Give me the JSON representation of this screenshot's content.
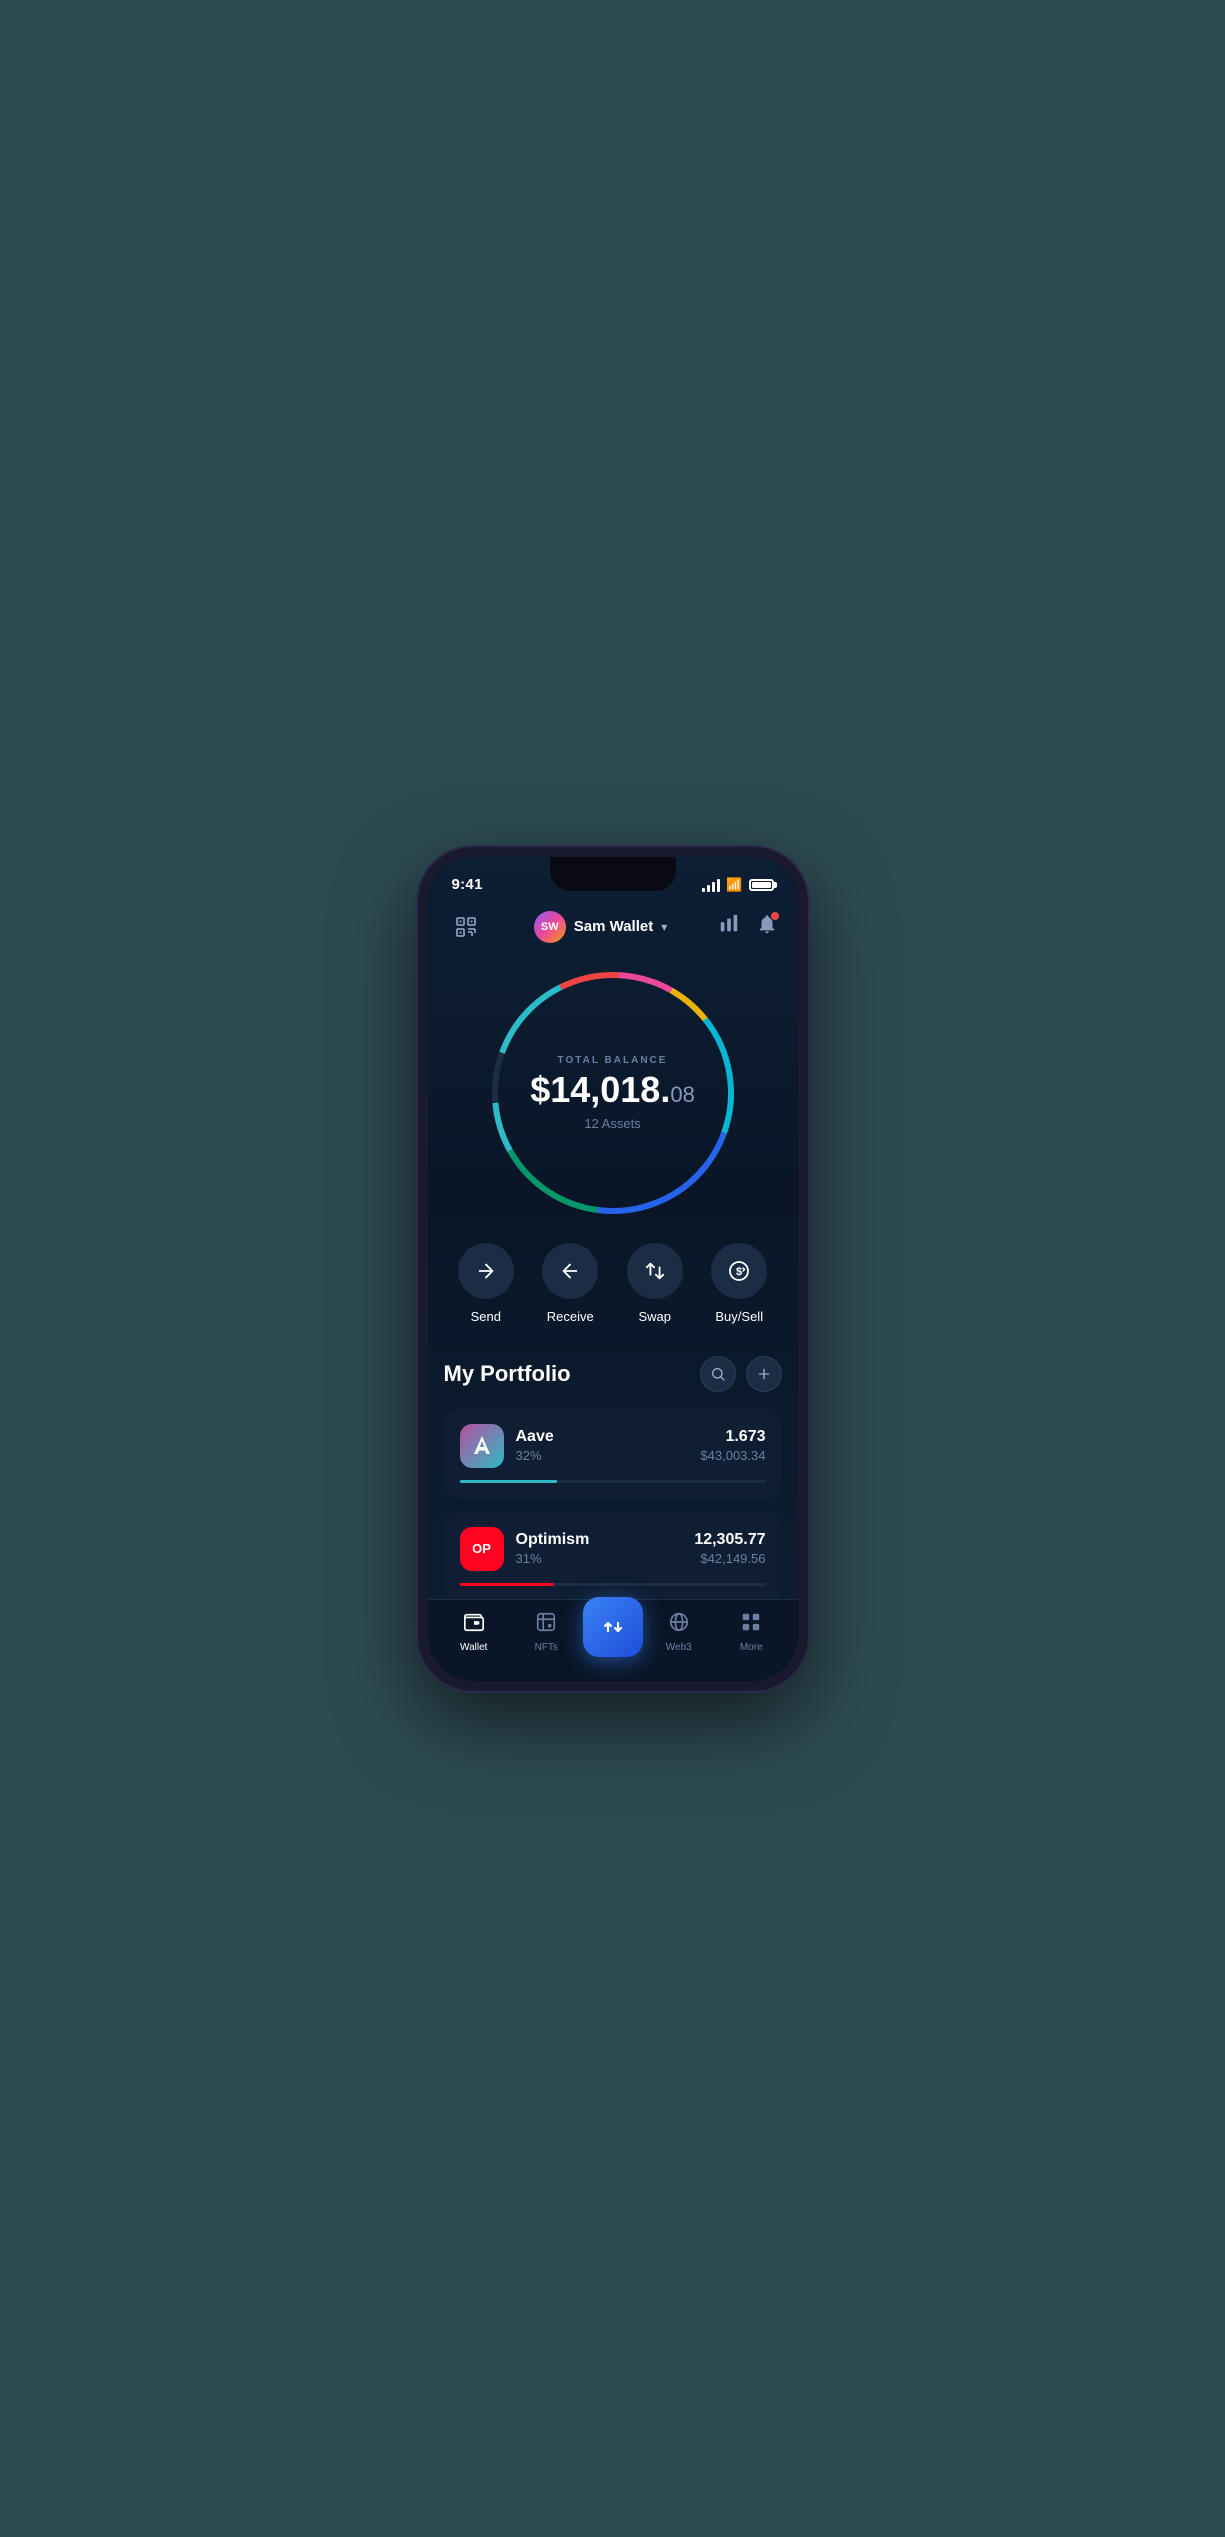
{
  "status_bar": {
    "time": "9:41"
  },
  "header": {
    "scan_label": "scan",
    "wallet_initials": "SW",
    "wallet_name": "Sam Wallet",
    "chevron": "▾",
    "chart_label": "chart",
    "notification_label": "notification"
  },
  "balance": {
    "label": "TOTAL BALANCE",
    "amount_main": "$14,018.",
    "amount_cents": "08",
    "assets_label": "12 Assets"
  },
  "actions": [
    {
      "id": "send",
      "label": "Send",
      "icon": "→"
    },
    {
      "id": "receive",
      "label": "Receive",
      "icon": "←"
    },
    {
      "id": "swap",
      "label": "Swap",
      "icon": "⇅"
    },
    {
      "id": "buysell",
      "label": "Buy/Sell",
      "icon": "ⓢ"
    }
  ],
  "portfolio": {
    "title": "My Portfolio",
    "search_label": "search",
    "add_label": "add",
    "assets": [
      {
        "id": "aave",
        "name": "Aave",
        "pct": "32%",
        "amount": "1.673",
        "usd": "$43,003.34",
        "progress": 32,
        "progress_color": "#2ebac6",
        "logo_text": "Λ"
      },
      {
        "id": "optimism",
        "name": "Optimism",
        "pct": "31%",
        "amount": "12,305.77",
        "usd": "$42,149.56",
        "progress": 31,
        "progress_color": "#ff0420",
        "logo_text": "OP"
      }
    ]
  },
  "bottom_nav": {
    "items": [
      {
        "id": "wallet",
        "label": "Wallet",
        "icon": "wallet",
        "active": true
      },
      {
        "id": "nfts",
        "label": "NFTs",
        "icon": "nfts",
        "active": false
      },
      {
        "id": "center",
        "label": "",
        "icon": "swap-center",
        "active": false
      },
      {
        "id": "web3",
        "label": "Web3",
        "icon": "web3",
        "active": false
      },
      {
        "id": "more",
        "label": "More",
        "icon": "more",
        "active": false
      }
    ]
  },
  "colors": {
    "bg_dark": "#0a1628",
    "bg_card": "#0f1e32",
    "accent_blue": "#3b82f6",
    "text_primary": "#ffffff",
    "text_secondary": "#6b7fa3"
  }
}
